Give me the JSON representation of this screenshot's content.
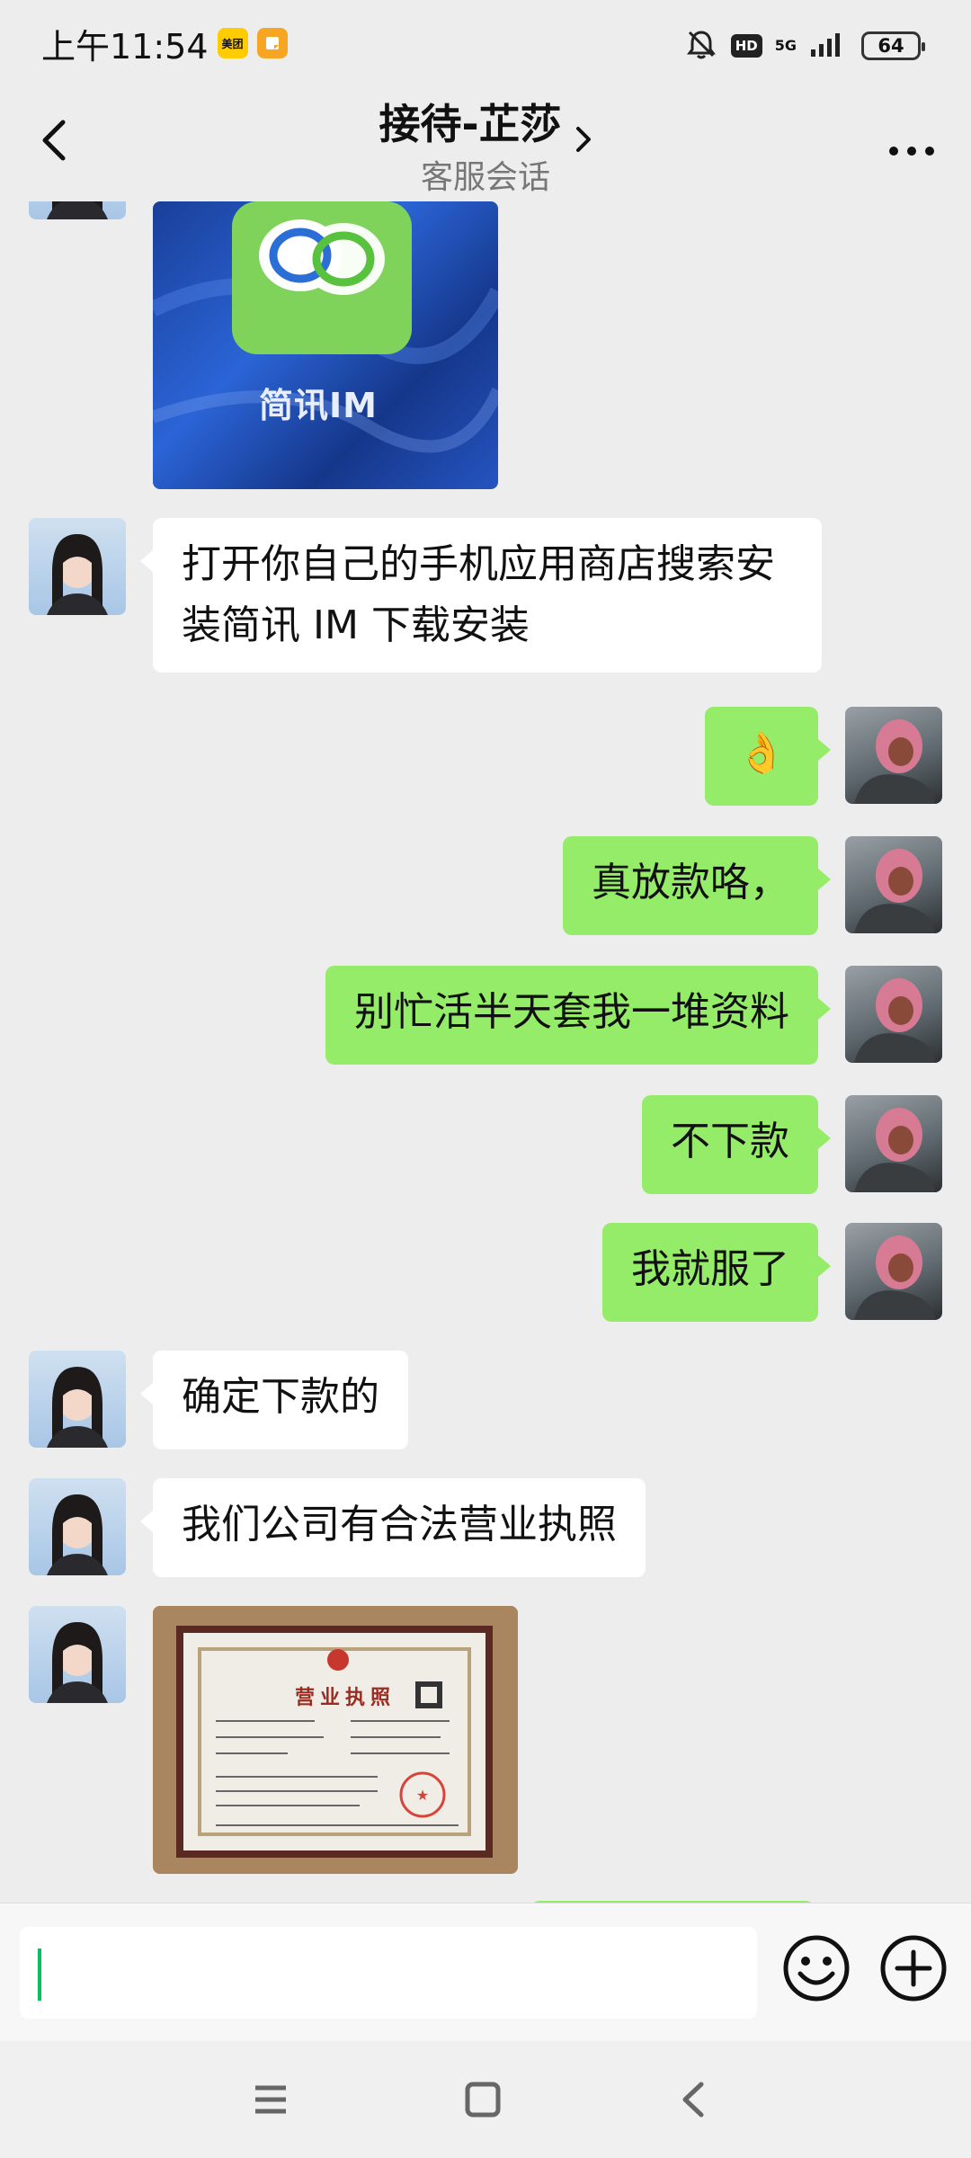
{
  "status_bar": {
    "time": "上午11:54",
    "badges": [
      "meituan-icon",
      "note-icon"
    ],
    "hd_label": "HD",
    "network_label": "5G",
    "battery": "64"
  },
  "header": {
    "title": "接待-芷莎",
    "subtitle": "客服会话",
    "icons": [
      "back-arrow-icon",
      "chevron-right-icon",
      "more-dots-icon"
    ]
  },
  "chat": {
    "app_promo_caption": "简讯IM",
    "messages": [
      {
        "side": "in",
        "text": "打开你自己的手机应用商店搜索安装简讯 IM 下载安装"
      },
      {
        "side": "out",
        "text": "👌"
      },
      {
        "side": "out",
        "text": "真放款咯，"
      },
      {
        "side": "out",
        "text": "别忙活半天套我一堆资料"
      },
      {
        "side": "out",
        "text": "不下款"
      },
      {
        "side": "out",
        "text": "我就服了"
      },
      {
        "side": "in",
        "text": "确定下款的"
      },
      {
        "side": "in",
        "text": "我们公司有合法营业执照"
      }
    ],
    "license_title": "营业执照"
  },
  "input": {
    "value": "",
    "icons": [
      "emoji-icon",
      "plus-icon"
    ]
  },
  "system_nav": {
    "icons": [
      "menu-icon",
      "home-square-icon",
      "back-icon"
    ]
  },
  "colors": {
    "background": "#ededed",
    "bubble_out": "#95ec69",
    "bubble_in": "#ffffff",
    "caret": "#07c160"
  }
}
